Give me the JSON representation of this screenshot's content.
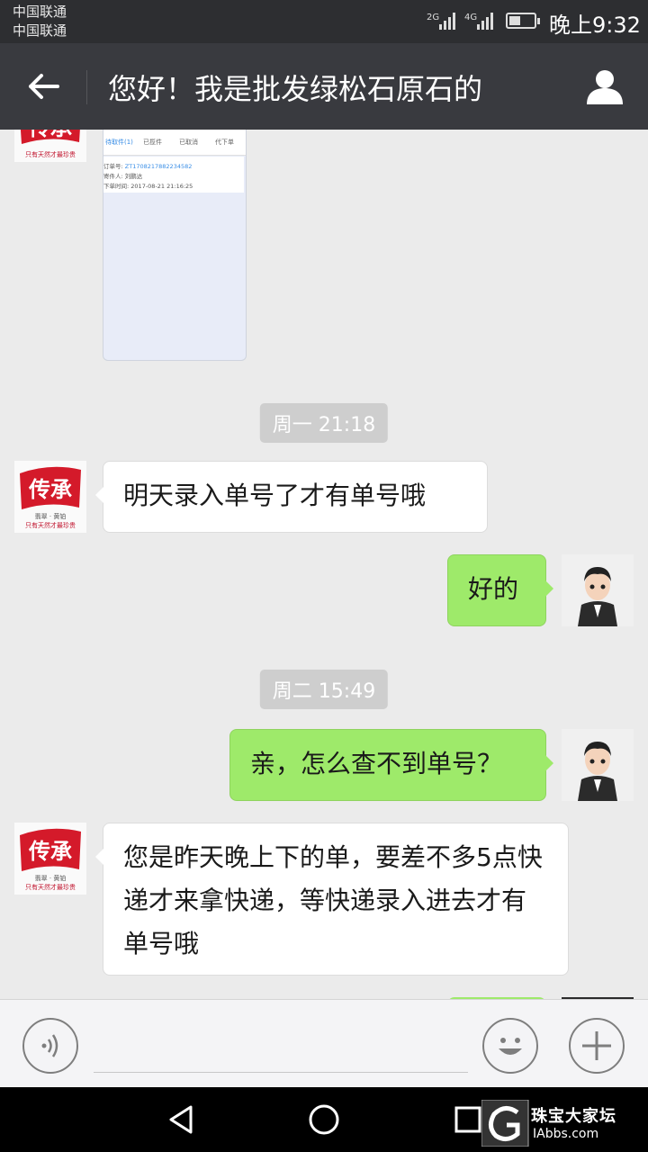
{
  "status_bar": {
    "carrier_1": "中国联通",
    "carrier_2": "中国联通",
    "network_2g": "2G",
    "network_4g": "4G",
    "time": "晚上9:32"
  },
  "header": {
    "title": "您好！我是批发绿松石原石的",
    "back_icon": "arrow-left-icon",
    "profile_icon": "person-icon"
  },
  "shared_screenshot": {
    "tabs": [
      "待取件(1)",
      "已揽件",
      "已取消",
      "代下单"
    ],
    "order_label": "订单号:",
    "order_no": "ZT1708217882234582",
    "sender_label": "寄件人:",
    "sender": "刘鹏达",
    "time_label": "下单时间:",
    "order_time": "2017-08-21 21:16:25"
  },
  "brand_avatar": {
    "chars": "传承",
    "sub_label": "珠宝",
    "tagline": "翡翠 · 黄铂",
    "slogan": "只有天然才最珍贵"
  },
  "messages": [
    {
      "type": "timestamp",
      "text": "周一 21:18"
    },
    {
      "type": "left",
      "text": "明天录入单号了才有单号哦"
    },
    {
      "type": "right",
      "text": "好的"
    },
    {
      "type": "timestamp",
      "text": "周二 15:49"
    },
    {
      "type": "right",
      "text": "亲，怎么查不到单号？"
    },
    {
      "type": "left",
      "text": "您是昨天晚上下的单，要差不多5点快递才来拿快递，等快递录入进去才有单号哦"
    }
  ],
  "input_bar": {
    "voice_icon": "voice-icon",
    "emoji_icon": "smiley-icon",
    "add_icon": "plus-icon"
  },
  "watermark": {
    "site": "珠宝大家坛",
    "domain": "IAbbs.com"
  },
  "colors": {
    "title_bar": "#393a3f",
    "status_bar": "#2d2e31",
    "chat_bg": "#ebebeb",
    "bubble_right": "#9eea6a",
    "bubble_left": "#ffffff",
    "timestamp_bg": "#cecece"
  }
}
